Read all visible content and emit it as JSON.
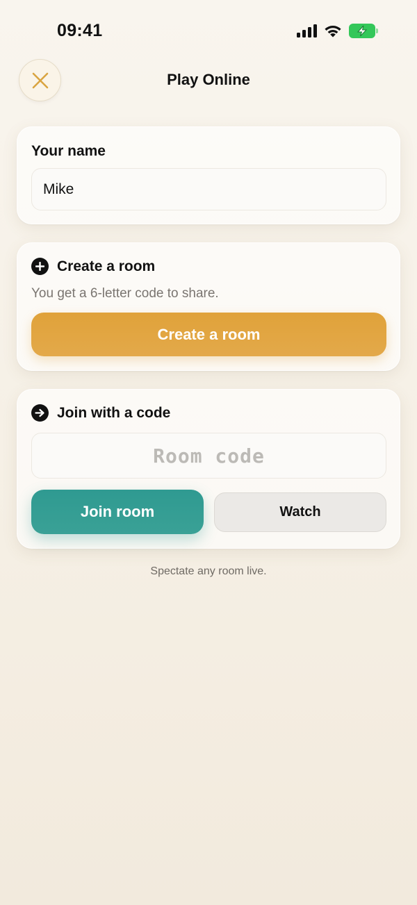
{
  "status_bar": {
    "time": "09:41"
  },
  "header": {
    "title": "Play Online",
    "close_icon": "close-icon",
    "accent_color": "#d9a441"
  },
  "name_card": {
    "label": "Your name",
    "input_value": "Mike"
  },
  "create_card": {
    "icon": "plus-circle-icon",
    "title": "Create a room",
    "hint": "You get a 6-letter code to share.",
    "button_label": "Create a room",
    "button_color": "#e0a23a"
  },
  "join_card": {
    "icon": "arrow-right-circle-icon",
    "title": "Join with a code",
    "code_placeholder": "Room code",
    "join_button_label": "Join room",
    "join_button_color": "#2f9a91",
    "watch_button_label": "Watch"
  },
  "footer": {
    "note": "Spectate any room live."
  }
}
